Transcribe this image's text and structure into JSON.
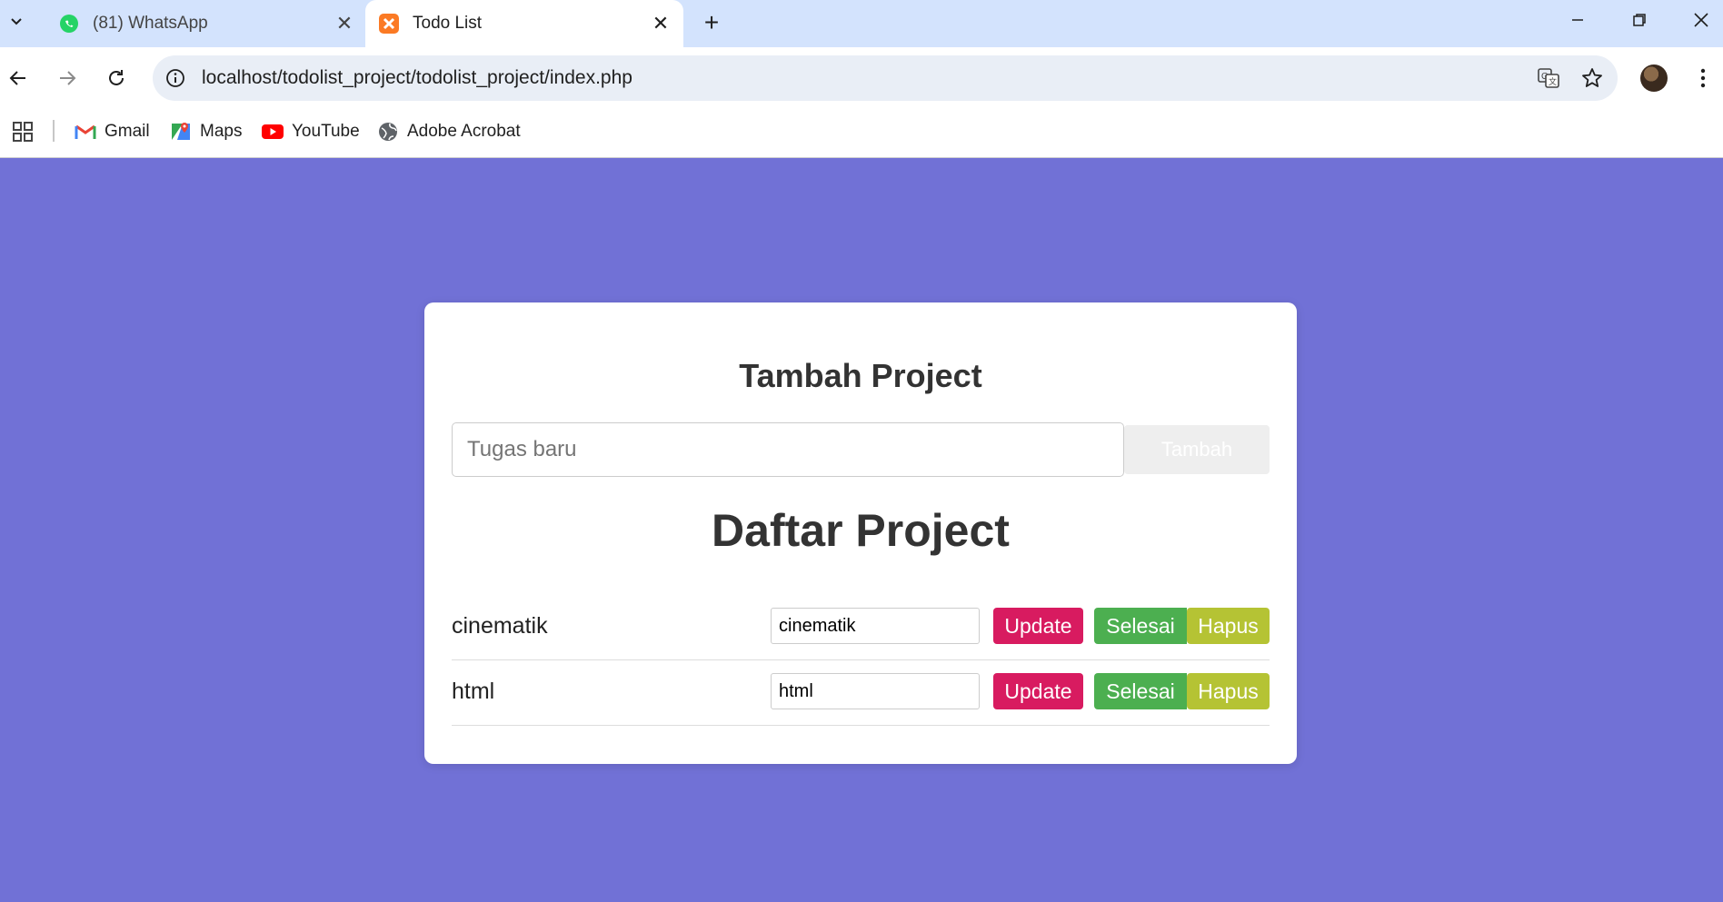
{
  "browser": {
    "tabs": [
      {
        "title": "(81) WhatsApp",
        "icon": "whatsapp-icon",
        "active": false
      },
      {
        "title": "Todo List",
        "icon": "xampp-icon",
        "active": true
      }
    ],
    "url": "localhost/todolist_project/todolist_project/index.php",
    "bookmarks": [
      {
        "label": "Gmail",
        "icon": "gmail-icon"
      },
      {
        "label": "Maps",
        "icon": "maps-icon"
      },
      {
        "label": "YouTube",
        "icon": "youtube-icon"
      },
      {
        "label": "Adobe Acrobat",
        "icon": "globe-icon"
      }
    ]
  },
  "page": {
    "add_heading": "Tambah Project",
    "input_placeholder": "Tugas baru",
    "add_button": "Tambah",
    "list_heading": "Daftar Project",
    "tasks": [
      {
        "name": "cinematik",
        "edit_value": "cinematik",
        "update_label": "Update",
        "done_label": "Selesai",
        "delete_label": "Hapus"
      },
      {
        "name": "html",
        "edit_value": "html",
        "update_label": "Update",
        "done_label": "Selesai",
        "delete_label": "Hapus"
      }
    ]
  },
  "colors": {
    "background": "#7171d6",
    "update": "#d81b60",
    "selesai": "#4caf50",
    "hapus": "#b5c334"
  }
}
